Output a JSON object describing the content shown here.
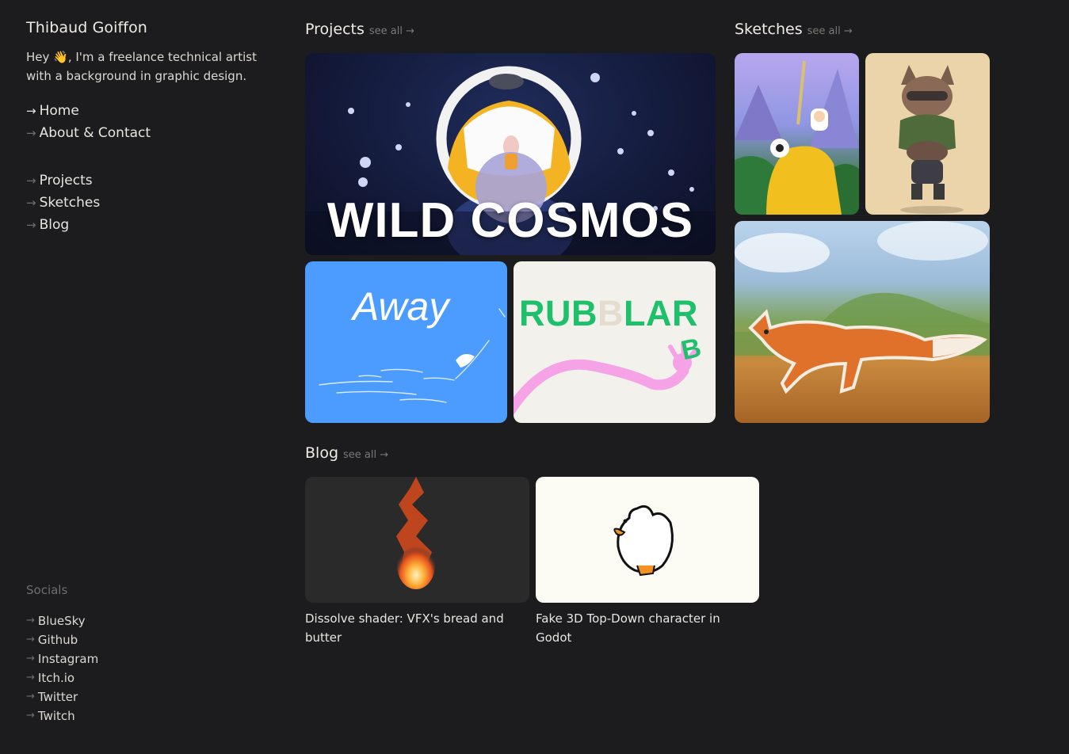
{
  "sidebar": {
    "name": "Thibaud Goiffon",
    "intro": "Hey 👋, I'm a freelance technical artist with a background in graphic design.",
    "nav": [
      {
        "label": "Home",
        "active": true
      },
      {
        "label": "About & Contact",
        "active": false
      }
    ],
    "sections": [
      {
        "label": "Projects"
      },
      {
        "label": "Sketches"
      },
      {
        "label": "Blog"
      }
    ],
    "arrow": "→"
  },
  "socials": {
    "title": "Socials",
    "items": [
      "BlueSky",
      "Github",
      "Instagram",
      "Itch.io",
      "Twitter",
      "Twitch"
    ]
  },
  "projects": {
    "title": "Projects",
    "see_all": "see all →",
    "items": [
      {
        "title": "WILD COSMOS"
      },
      {
        "title": "Away"
      },
      {
        "title_parts": [
          "RUB",
          "B",
          "LAR"
        ],
        "badge": "B"
      }
    ]
  },
  "sketches": {
    "title": "Sketches",
    "see_all": "see all →"
  },
  "blog": {
    "title": "Blog",
    "see_all": "see all →",
    "posts": [
      {
        "title": "Dissolve shader: VFX's bread and butter"
      },
      {
        "title": "Fake 3D Top-Down character in Godot"
      }
    ]
  },
  "colors": {
    "background": "#1c1c1e",
    "text": "#e8e6e1",
    "muted": "#6f6e6b",
    "away_blue": "#4c9cff",
    "rubblar_green": "#1fc06b"
  }
}
